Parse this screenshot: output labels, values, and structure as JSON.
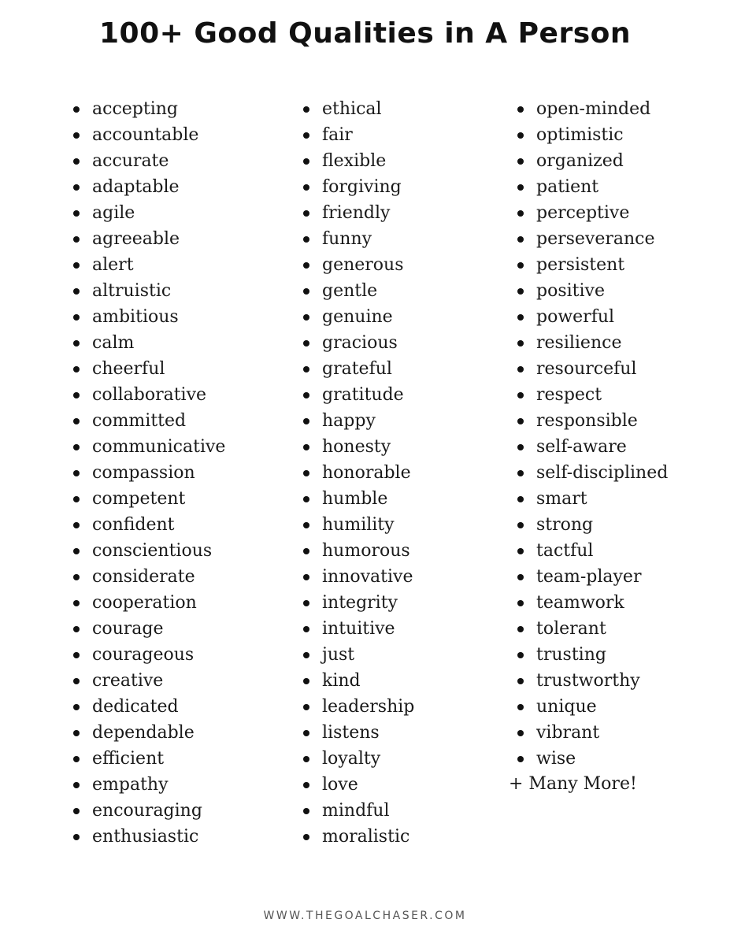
{
  "title": "100+ Good Qualities in A Person",
  "columns": [
    [
      "accepting",
      "accountable",
      "accurate",
      "adaptable",
      "agile",
      "agreeable",
      "alert",
      "altruistic",
      "ambitious",
      "calm",
      "cheerful",
      "collaborative",
      "committed",
      "communicative",
      "compassion",
      "competent",
      "confident",
      "conscientious",
      "considerate",
      "cooperation",
      "courage",
      "courageous",
      "creative",
      "dedicated",
      "dependable",
      "efficient",
      "empathy",
      "encouraging",
      "enthusiastic"
    ],
    [
      "ethical",
      "fair",
      "flexible",
      "forgiving",
      "friendly",
      "funny",
      "generous",
      "gentle",
      "genuine",
      "gracious",
      "grateful",
      "gratitude",
      "happy",
      "honesty",
      "honorable",
      "humble",
      "humility",
      "humorous",
      "innovative",
      "integrity",
      "intuitive",
      "just",
      "kind",
      "leadership",
      "listens",
      "loyalty",
      "love",
      "mindful",
      "moralistic"
    ],
    [
      "open-minded",
      "optimistic",
      "organized",
      "patient",
      "perceptive",
      "perseverance",
      "persistent",
      "positive",
      "powerful",
      "resilience",
      "resourceful",
      "respect",
      "responsible",
      "self-aware",
      "self-disciplined",
      "smart",
      "strong",
      "tactful",
      "team-player",
      "teamwork",
      "tolerant",
      "trusting",
      "trustworthy",
      "unique",
      "vibrant",
      "wise"
    ]
  ],
  "more": "+ Many More!",
  "footer": "WWW.THEGOALCHASER.COM"
}
